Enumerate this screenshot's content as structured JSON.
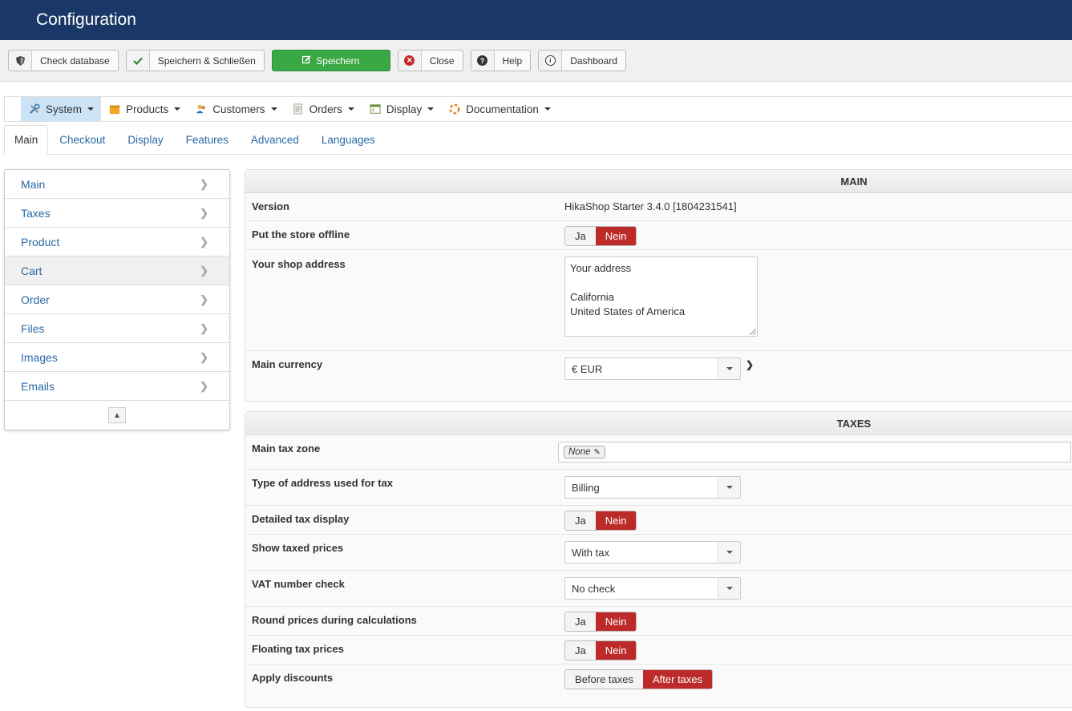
{
  "header": {
    "title": "Configuration"
  },
  "toolbar": {
    "check_database": "Check database",
    "save_close": "Speichern & Schließen",
    "save": "Speichern",
    "close": "Close",
    "help": "Help",
    "dashboard": "Dashboard"
  },
  "menu": {
    "system": "System",
    "products": "Products",
    "customers": "Customers",
    "orders": "Orders",
    "display": "Display",
    "documentation": "Documentation"
  },
  "tabs": {
    "main": "Main",
    "checkout": "Checkout",
    "display": "Display",
    "features": "Features",
    "advanced": "Advanced",
    "languages": "Languages"
  },
  "sidebar": {
    "items": [
      "Main",
      "Taxes",
      "Product",
      "Cart",
      "Order",
      "Files",
      "Images",
      "Emails"
    ]
  },
  "main_panel": {
    "title": "MAIN",
    "version_label": "Version",
    "version_value": "HikaShop Starter 3.4.0 [1804231541]",
    "offline_label": "Put the store offline",
    "address_label": "Your shop address",
    "address_line1": "Your address",
    "address_line3": "California",
    "address_line4": "United States of America",
    "currency_label": "Main currency",
    "currency_value": "€ EUR"
  },
  "taxes_panel": {
    "title": "TAXES",
    "tax_zone_label": "Main tax zone",
    "tax_zone_value": "None",
    "address_type_label": "Type of address used for tax",
    "address_type_value": "Billing",
    "detailed_label": "Detailed tax display",
    "show_taxed_label": "Show taxed prices",
    "show_taxed_value": "With tax",
    "vat_label": "VAT number check",
    "vat_value": "No check",
    "round_label": "Round prices during calculations",
    "floating_label": "Floating tax prices",
    "discounts_label": "Apply discounts",
    "discount_before": "Before taxes",
    "discount_after": "After taxes"
  },
  "toggle": {
    "yes": "Ja",
    "no": "Nein"
  },
  "colors": {
    "header": "#1a3867",
    "save": "#3aa845",
    "active_toggle": "#bd2a2a",
    "link": "#2a6aa5"
  }
}
